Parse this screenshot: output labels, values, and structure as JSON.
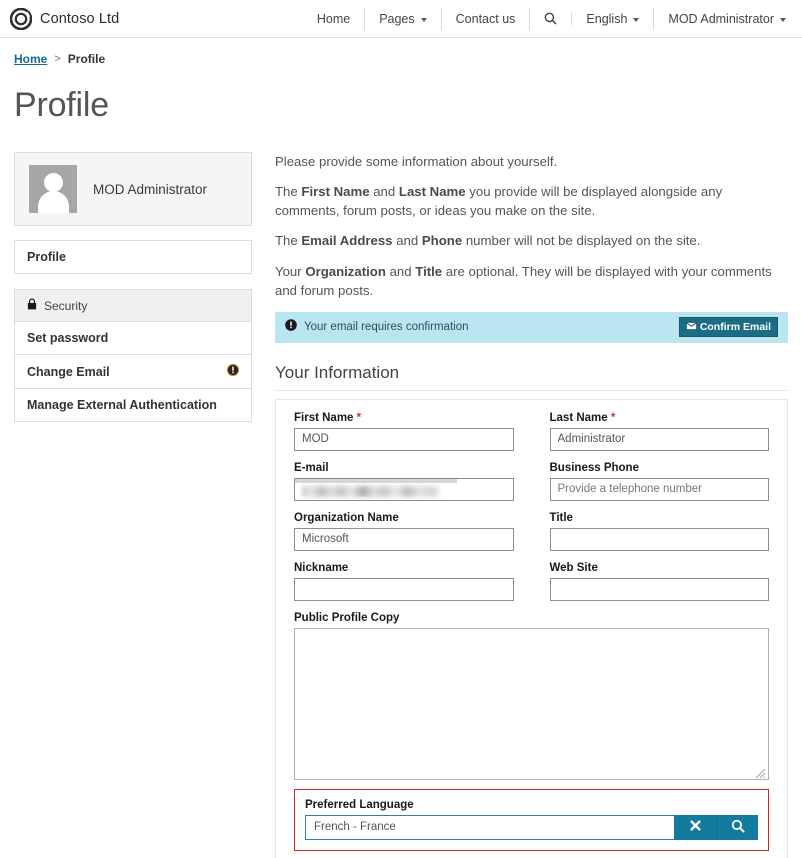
{
  "header": {
    "brand_name": "Contoso Ltd",
    "logo_icon": "contoso-ring-logo",
    "nav": [
      {
        "label": "Home",
        "icon": null,
        "has_caret": false
      },
      {
        "label": "Pages",
        "icon": null,
        "has_caret": true
      },
      {
        "label": "Contact us",
        "icon": null,
        "has_caret": false
      },
      {
        "label": "",
        "icon": "search-icon",
        "has_caret": false
      },
      {
        "label": "English",
        "icon": null,
        "has_caret": true
      },
      {
        "label": "MOD Administrator",
        "icon": null,
        "has_caret": true
      }
    ]
  },
  "breadcrumb": {
    "home_label": "Home",
    "separator": ">",
    "current_label": "Profile"
  },
  "page_title": "Profile",
  "sidebar": {
    "profile_card": {
      "avatar_icon": "user-avatar-placeholder",
      "name": "MOD Administrator"
    },
    "primary_menu": [
      {
        "label": "Profile"
      }
    ],
    "security_group": {
      "header_label": "Security",
      "header_icon": "lock-icon",
      "items": [
        {
          "label": "Set password",
          "badge": null
        },
        {
          "label": "Change Email",
          "badge": "info-exclamation-icon"
        },
        {
          "label": "Manage External Authentication",
          "badge": null
        }
      ]
    }
  },
  "main": {
    "intro": {
      "p1": "Please provide some information about yourself.",
      "p2_a": "The ",
      "p2_b1": "First Name",
      "p2_c": " and ",
      "p2_b2": "Last Name",
      "p2_d": " you provide will be displayed alongside any comments, forum posts, or ideas you make on the site.",
      "p3_a": "The ",
      "p3_b1": "Email Address",
      "p3_c": " and ",
      "p3_b2": "Phone",
      "p3_d": " number will not be displayed on the site.",
      "p4_a": "Your ",
      "p4_b1": "Organization",
      "p4_c": " and ",
      "p4_b2": "Title",
      "p4_d": " are optional. They will be displayed with your comments and forum posts."
    },
    "alert": {
      "icon": "info-exclamation-icon",
      "message": "Your email requires confirmation",
      "button_label": "Confirm Email",
      "button_icon": "envelope-icon",
      "background_color": "#b8e5ef",
      "button_color": "#1b6d85"
    },
    "section_title": "Your Information",
    "fields": {
      "first_name": {
        "label": "First Name",
        "required": true,
        "value": "MOD",
        "placeholder": ""
      },
      "last_name": {
        "label": "Last Name",
        "required": true,
        "value": "Administrator",
        "placeholder": ""
      },
      "email": {
        "label": "E-mail",
        "required": false,
        "value": "",
        "placeholder": "",
        "redacted": true
      },
      "business_phone": {
        "label": "Business Phone",
        "required": false,
        "value": "",
        "placeholder": "Provide a telephone number"
      },
      "organization_name": {
        "label": "Organization Name",
        "required": false,
        "value": "Microsoft",
        "placeholder": ""
      },
      "title": {
        "label": "Title",
        "required": false,
        "value": "",
        "placeholder": ""
      },
      "nickname": {
        "label": "Nickname",
        "required": false,
        "value": "",
        "placeholder": ""
      },
      "web_site": {
        "label": "Web Site",
        "required": false,
        "value": "",
        "placeholder": ""
      },
      "public_profile_copy": {
        "label": "Public Profile Copy",
        "required": false,
        "value": "",
        "placeholder": ""
      },
      "preferred_language": {
        "label": "Preferred Language",
        "value": "French - France",
        "placeholder": "",
        "clear_icon": "close-x-icon",
        "search_icon": "search-icon",
        "highlight_color": "#cc2a2a",
        "button_color": "#147a9e"
      }
    }
  }
}
